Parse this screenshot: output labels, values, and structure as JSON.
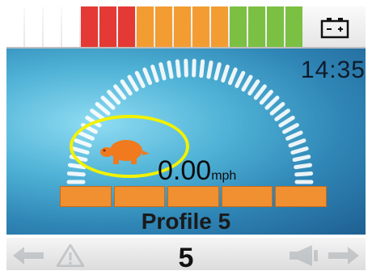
{
  "status": {
    "battery_level_colors": [
      "#ffffff",
      "#ffffff",
      "#ffffff",
      "#ffffff",
      "#e53935",
      "#e53935",
      "#e53935",
      "#f39c32",
      "#f39c32",
      "#f39c32",
      "#f39c32",
      "#f39c32",
      "#7bc043",
      "#7bc043",
      "#7bc043",
      "#7bc043"
    ],
    "battery_icon": "battery-icon"
  },
  "display": {
    "time": "14:35",
    "speed_value": "0.00",
    "speed_unit": "mph",
    "mode_icon": "turtle-icon",
    "profile_label": "Profile 5",
    "speed_level_segments": 5
  },
  "footer": {
    "selected_number": "5",
    "left_icons": [
      "arrow-left-icon",
      "warning-triangle-icon"
    ],
    "right_icons": [
      "horn-icon",
      "arrow-right-icon"
    ]
  },
  "colors": {
    "accent_orange": "#f09030",
    "highlight_yellow": "#f2f200"
  }
}
